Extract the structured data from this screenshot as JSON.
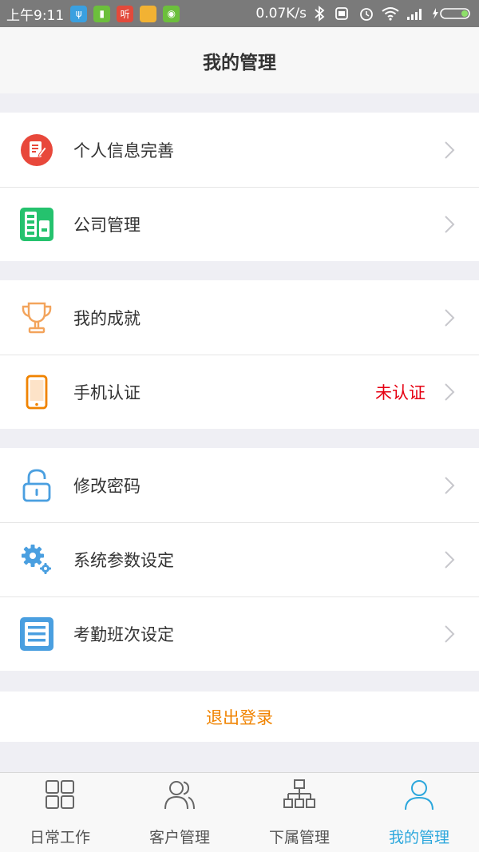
{
  "status_bar": {
    "time": "上午9:11",
    "app_badges": [
      {
        "icon": "usb-icon",
        "glyph": "ψ",
        "color": "#3aa0e0"
      },
      {
        "icon": "battery-app-icon",
        "glyph": "▮",
        "color": "#6cbf3c"
      },
      {
        "icon": "listen-app-icon",
        "glyph": "听",
        "color": "#e24a3b"
      },
      {
        "icon": "folder-app-icon",
        "glyph": "",
        "color": "#f2b233"
      },
      {
        "icon": "android-icon",
        "glyph": "◉",
        "color": "#6cbf3c"
      }
    ],
    "network_speed": "0.07K/s"
  },
  "header": {
    "title": "我的管理"
  },
  "menu_groups": [
    {
      "items": [
        {
          "label": "个人信息完善",
          "icon": "profile-edit-icon",
          "status": ""
        },
        {
          "label": "公司管理",
          "icon": "company-building-icon",
          "status": ""
        }
      ]
    },
    {
      "items": [
        {
          "label": "我的成就",
          "icon": "trophy-icon",
          "status": ""
        },
        {
          "label": "手机认证",
          "icon": "phone-icon",
          "status": "未认证"
        }
      ]
    },
    {
      "items": [
        {
          "label": "修改密码",
          "icon": "unlock-icon",
          "status": ""
        },
        {
          "label": "系统参数设定",
          "icon": "gear-icon",
          "status": ""
        },
        {
          "label": "考勤班次设定",
          "icon": "list-document-icon",
          "status": ""
        }
      ]
    }
  ],
  "logout": {
    "label": "退出登录"
  },
  "tabbar": {
    "tabs": [
      {
        "label": "日常工作",
        "icon": "grid-icon",
        "active": false
      },
      {
        "label": "客户管理",
        "icon": "customers-icon",
        "active": false
      },
      {
        "label": "下属管理",
        "icon": "org-chart-icon",
        "active": false
      },
      {
        "label": "我的管理",
        "icon": "user-icon",
        "active": true
      }
    ]
  },
  "colors": {
    "accent": "#2ca7dc",
    "warning": "#e60012",
    "logout": "#f08300",
    "profile_icon": "#e8483b",
    "company_icon": "#25c26e",
    "trophy_icon": "#f3a45c",
    "phone_icon": "#f08300",
    "settings_icon": "#4a9fe0"
  }
}
